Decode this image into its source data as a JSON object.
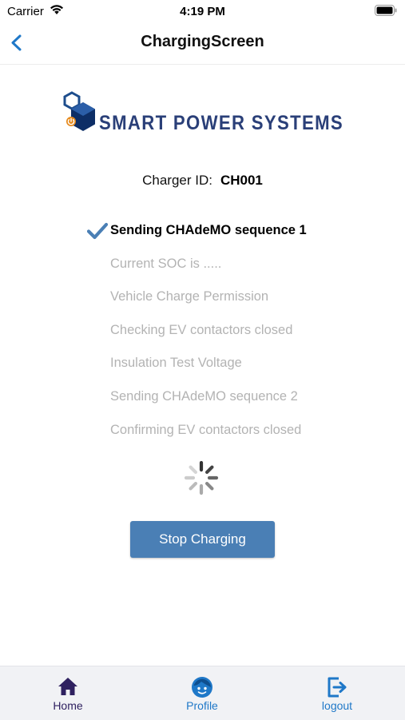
{
  "status_bar": {
    "carrier": "Carrier",
    "time": "4:19 PM"
  },
  "nav": {
    "title": "ChargingScreen"
  },
  "logo": {
    "text": "SMART POWER SYSTEMS"
  },
  "charger": {
    "label": "Charger ID:",
    "id": "CH001"
  },
  "steps": [
    {
      "label": "Sending CHAdeMO sequence 1",
      "state": "done"
    },
    {
      "label": "Current SOC is .....",
      "state": "pending"
    },
    {
      "label": "Vehicle Charge Permission",
      "state": "pending"
    },
    {
      "label": "Checking EV contactors closed",
      "state": "pending"
    },
    {
      "label": "Insulation Test Voltage",
      "state": "pending"
    },
    {
      "label": "Sending CHAdeMO sequence 2",
      "state": "pending"
    },
    {
      "label": "Confirming EV contactors closed",
      "state": "pending"
    }
  ],
  "actions": {
    "stop_label": "Stop Charging"
  },
  "tabs": [
    {
      "label": "Home",
      "icon": "home-icon"
    },
    {
      "label": "Profile",
      "icon": "profile-icon"
    },
    {
      "label": "logout",
      "icon": "logout-icon"
    }
  ],
  "colors": {
    "accent": "#1f78c8",
    "button": "#4a7fb5",
    "check": "#4a7fb5",
    "pending_text": "#b3b3b3",
    "home_tab": "#2f2160"
  }
}
